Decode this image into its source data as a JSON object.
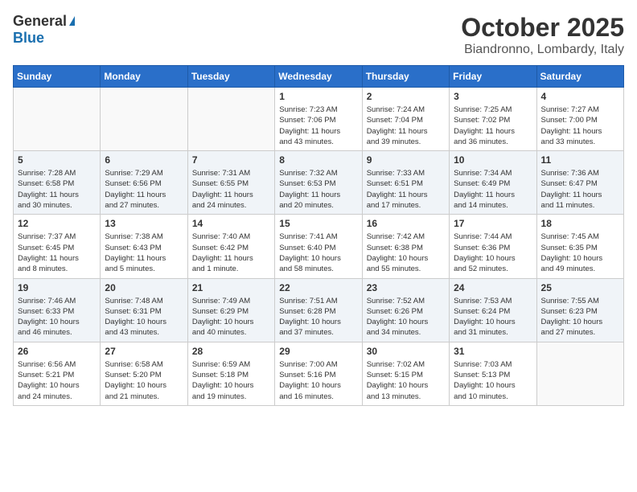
{
  "header": {
    "logo_general": "General",
    "logo_blue": "Blue",
    "month": "October 2025",
    "location": "Biandronno, Lombardy, Italy"
  },
  "weekdays": [
    "Sunday",
    "Monday",
    "Tuesday",
    "Wednesday",
    "Thursday",
    "Friday",
    "Saturday"
  ],
  "weeks": [
    [
      {
        "day": "",
        "info": ""
      },
      {
        "day": "",
        "info": ""
      },
      {
        "day": "",
        "info": ""
      },
      {
        "day": "1",
        "info": "Sunrise: 7:23 AM\nSunset: 7:06 PM\nDaylight: 11 hours\nand 43 minutes."
      },
      {
        "day": "2",
        "info": "Sunrise: 7:24 AM\nSunset: 7:04 PM\nDaylight: 11 hours\nand 39 minutes."
      },
      {
        "day": "3",
        "info": "Sunrise: 7:25 AM\nSunset: 7:02 PM\nDaylight: 11 hours\nand 36 minutes."
      },
      {
        "day": "4",
        "info": "Sunrise: 7:27 AM\nSunset: 7:00 PM\nDaylight: 11 hours\nand 33 minutes."
      }
    ],
    [
      {
        "day": "5",
        "info": "Sunrise: 7:28 AM\nSunset: 6:58 PM\nDaylight: 11 hours\nand 30 minutes."
      },
      {
        "day": "6",
        "info": "Sunrise: 7:29 AM\nSunset: 6:56 PM\nDaylight: 11 hours\nand 27 minutes."
      },
      {
        "day": "7",
        "info": "Sunrise: 7:31 AM\nSunset: 6:55 PM\nDaylight: 11 hours\nand 24 minutes."
      },
      {
        "day": "8",
        "info": "Sunrise: 7:32 AM\nSunset: 6:53 PM\nDaylight: 11 hours\nand 20 minutes."
      },
      {
        "day": "9",
        "info": "Sunrise: 7:33 AM\nSunset: 6:51 PM\nDaylight: 11 hours\nand 17 minutes."
      },
      {
        "day": "10",
        "info": "Sunrise: 7:34 AM\nSunset: 6:49 PM\nDaylight: 11 hours\nand 14 minutes."
      },
      {
        "day": "11",
        "info": "Sunrise: 7:36 AM\nSunset: 6:47 PM\nDaylight: 11 hours\nand 11 minutes."
      }
    ],
    [
      {
        "day": "12",
        "info": "Sunrise: 7:37 AM\nSunset: 6:45 PM\nDaylight: 11 hours\nand 8 minutes."
      },
      {
        "day": "13",
        "info": "Sunrise: 7:38 AM\nSunset: 6:43 PM\nDaylight: 11 hours\nand 5 minutes."
      },
      {
        "day": "14",
        "info": "Sunrise: 7:40 AM\nSunset: 6:42 PM\nDaylight: 11 hours\nand 1 minute."
      },
      {
        "day": "15",
        "info": "Sunrise: 7:41 AM\nSunset: 6:40 PM\nDaylight: 10 hours\nand 58 minutes."
      },
      {
        "day": "16",
        "info": "Sunrise: 7:42 AM\nSunset: 6:38 PM\nDaylight: 10 hours\nand 55 minutes."
      },
      {
        "day": "17",
        "info": "Sunrise: 7:44 AM\nSunset: 6:36 PM\nDaylight: 10 hours\nand 52 minutes."
      },
      {
        "day": "18",
        "info": "Sunrise: 7:45 AM\nSunset: 6:35 PM\nDaylight: 10 hours\nand 49 minutes."
      }
    ],
    [
      {
        "day": "19",
        "info": "Sunrise: 7:46 AM\nSunset: 6:33 PM\nDaylight: 10 hours\nand 46 minutes."
      },
      {
        "day": "20",
        "info": "Sunrise: 7:48 AM\nSunset: 6:31 PM\nDaylight: 10 hours\nand 43 minutes."
      },
      {
        "day": "21",
        "info": "Sunrise: 7:49 AM\nSunset: 6:29 PM\nDaylight: 10 hours\nand 40 minutes."
      },
      {
        "day": "22",
        "info": "Sunrise: 7:51 AM\nSunset: 6:28 PM\nDaylight: 10 hours\nand 37 minutes."
      },
      {
        "day": "23",
        "info": "Sunrise: 7:52 AM\nSunset: 6:26 PM\nDaylight: 10 hours\nand 34 minutes."
      },
      {
        "day": "24",
        "info": "Sunrise: 7:53 AM\nSunset: 6:24 PM\nDaylight: 10 hours\nand 31 minutes."
      },
      {
        "day": "25",
        "info": "Sunrise: 7:55 AM\nSunset: 6:23 PM\nDaylight: 10 hours\nand 27 minutes."
      }
    ],
    [
      {
        "day": "26",
        "info": "Sunrise: 6:56 AM\nSunset: 5:21 PM\nDaylight: 10 hours\nand 24 minutes."
      },
      {
        "day": "27",
        "info": "Sunrise: 6:58 AM\nSunset: 5:20 PM\nDaylight: 10 hours\nand 21 minutes."
      },
      {
        "day": "28",
        "info": "Sunrise: 6:59 AM\nSunset: 5:18 PM\nDaylight: 10 hours\nand 19 minutes."
      },
      {
        "day": "29",
        "info": "Sunrise: 7:00 AM\nSunset: 5:16 PM\nDaylight: 10 hours\nand 16 minutes."
      },
      {
        "day": "30",
        "info": "Sunrise: 7:02 AM\nSunset: 5:15 PM\nDaylight: 10 hours\nand 13 minutes."
      },
      {
        "day": "31",
        "info": "Sunrise: 7:03 AM\nSunset: 5:13 PM\nDaylight: 10 hours\nand 10 minutes."
      },
      {
        "day": "",
        "info": ""
      }
    ]
  ]
}
